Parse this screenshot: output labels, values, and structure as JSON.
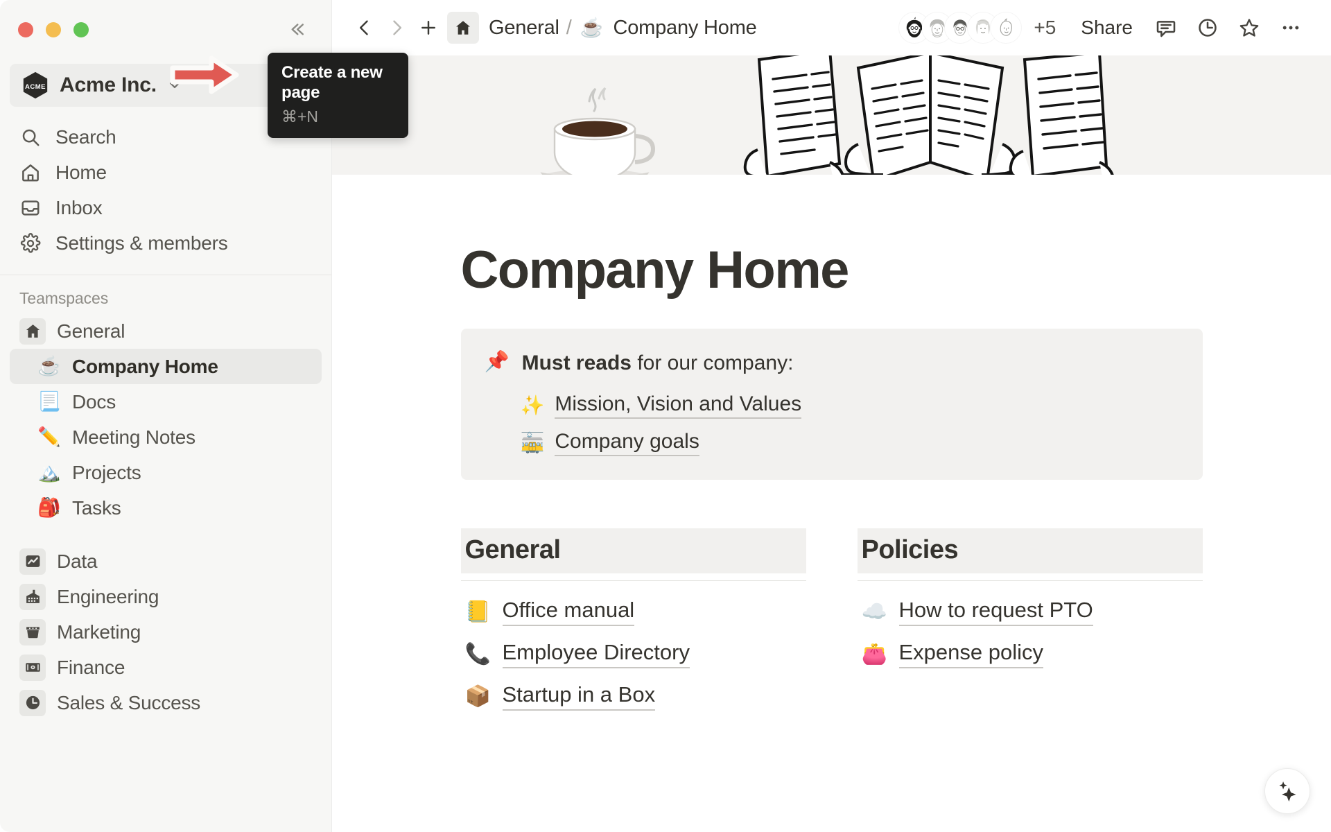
{
  "window": {
    "traffic_lights": [
      "close",
      "minimize",
      "maximize"
    ]
  },
  "sidebar": {
    "collapse_icon": "double-chevron-left-icon",
    "workspace": {
      "logo_text": "ACME",
      "name": "Acme Inc.",
      "chevron_icon": "chevron-down-icon",
      "new_page_icon": "edit-square-icon"
    },
    "nav": [
      {
        "label": "Search",
        "icon": "search-icon"
      },
      {
        "label": "Home",
        "icon": "home-icon"
      },
      {
        "label": "Inbox",
        "icon": "inbox-icon"
      },
      {
        "label": "Settings & members",
        "icon": "gear-icon"
      }
    ],
    "teamspaces_label": "Teamspaces",
    "general_teamspace": {
      "label": "General",
      "icon": "house-icon"
    },
    "general_pages": [
      {
        "label": "Company Home",
        "emoji": "☕",
        "active": true
      },
      {
        "label": "Docs",
        "emoji": "📃",
        "active": false
      },
      {
        "label": "Meeting Notes",
        "emoji": "✏️",
        "active": false
      },
      {
        "label": "Projects",
        "emoji": "🏔️",
        "active": false
      },
      {
        "label": "Tasks",
        "emoji": "🎒",
        "active": false
      }
    ],
    "other_teamspaces": [
      {
        "label": "Data",
        "icon": "chart-line-icon"
      },
      {
        "label": "Engineering",
        "icon": "factory-icon"
      },
      {
        "label": "Marketing",
        "icon": "megaphone-box-icon"
      },
      {
        "label": "Finance",
        "icon": "money-icon"
      },
      {
        "label": "Sales & Success",
        "icon": "clock-icon"
      }
    ]
  },
  "topbar": {
    "back_icon": "chevron-left-icon",
    "forward_icon": "chevron-right-icon",
    "new_icon": "plus-icon",
    "breadcrumb": {
      "teamspace_icon": "house-icon",
      "teamspace": "General",
      "separator": "/",
      "page_emoji": "☕",
      "page": "Company Home"
    },
    "avatar_count": 5,
    "overflow_label": "+5",
    "share_label": "Share",
    "actions": [
      {
        "name": "comment-icon"
      },
      {
        "name": "history-clock-icon"
      },
      {
        "name": "star-icon"
      },
      {
        "name": "more-horizontal-icon"
      }
    ]
  },
  "tooltip": {
    "title": "Create a new page",
    "shortcut": "⌘+N"
  },
  "page": {
    "title": "Company Home",
    "callout": {
      "emoji": "📌",
      "bold_text": "Must reads",
      "rest_text": " for our company:",
      "links": [
        {
          "emoji": "✨",
          "label": "Mission, Vision and Values"
        },
        {
          "emoji": "🚋",
          "label": "Company goals"
        }
      ]
    },
    "columns": [
      {
        "heading": "General",
        "links": [
          {
            "emoji": "📒",
            "label": "Office manual"
          },
          {
            "emoji": "📞",
            "label": "Employee Directory"
          },
          {
            "emoji": "📦",
            "label": "Startup in a Box"
          }
        ]
      },
      {
        "heading": "Policies",
        "links": [
          {
            "emoji": "☁️",
            "label": "How to request PTO"
          },
          {
            "emoji": "👛",
            "label": "Expense policy"
          }
        ]
      }
    ],
    "ai_button_icon": "sparkles-icon"
  },
  "colors": {
    "sidebar_bg": "#f7f7f5",
    "accent_arrow": "#e05a53",
    "tooltip_bg": "#1f1f1e",
    "cover_bg": "#f4f3f1",
    "callout_bg": "#f2f1ef",
    "active_item_bg": "#e9e9e7"
  }
}
